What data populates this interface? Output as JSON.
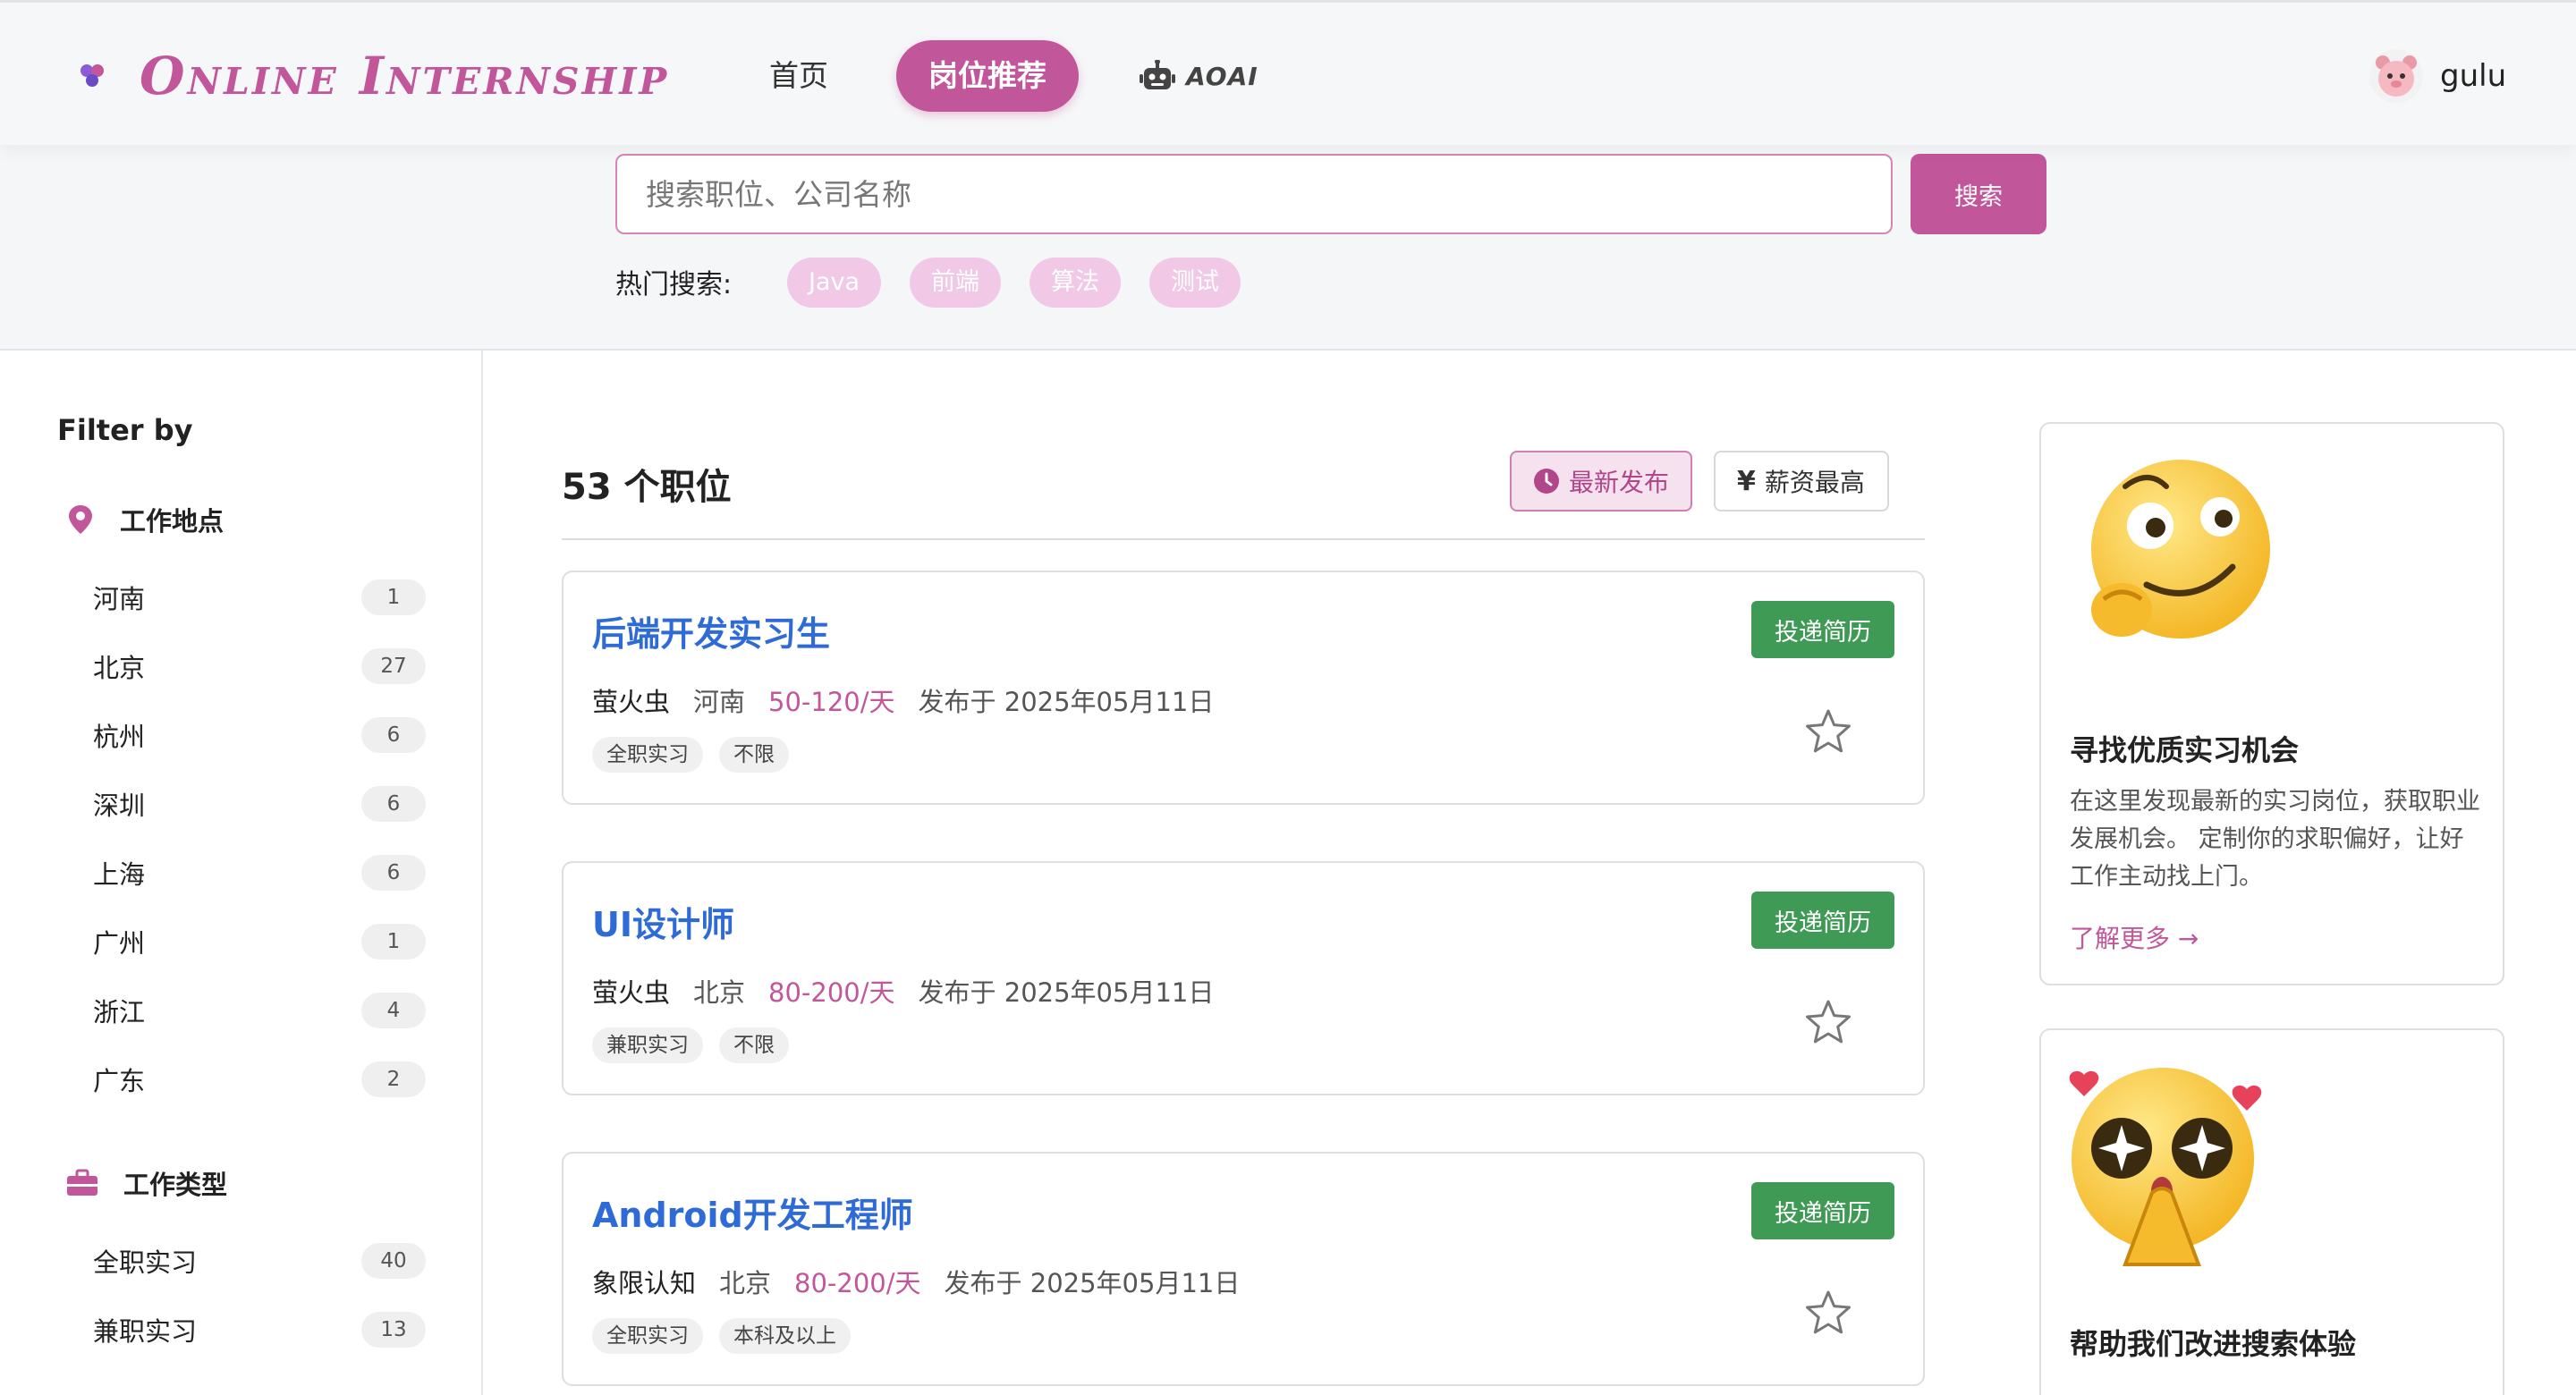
{
  "header": {
    "brand": "Online Internship",
    "nav": {
      "home": "首页",
      "jobs": "岗位推荐",
      "ai": "AOAI"
    },
    "user": {
      "name": "gulu"
    }
  },
  "search": {
    "placeholder": "搜索职位、公司名称",
    "button": "搜索",
    "hot_label": "热门搜索:",
    "hot_tags": [
      "Java",
      "前端",
      "算法",
      "测试"
    ]
  },
  "sidebar": {
    "title": "Filter by",
    "location_group": {
      "label": "工作地点",
      "items": [
        {
          "name": "河南",
          "count": "1"
        },
        {
          "name": "北京",
          "count": "27"
        },
        {
          "name": "杭州",
          "count": "6"
        },
        {
          "name": "深圳",
          "count": "6"
        },
        {
          "name": "上海",
          "count": "6"
        },
        {
          "name": "广州",
          "count": "1"
        },
        {
          "name": "浙江",
          "count": "4"
        },
        {
          "name": "广东",
          "count": "2"
        }
      ]
    },
    "type_group": {
      "label": "工作类型",
      "items": [
        {
          "name": "全职实习",
          "count": "40"
        },
        {
          "name": "兼职实习",
          "count": "13"
        }
      ]
    }
  },
  "main": {
    "count_text": "53 个职位",
    "sort": {
      "newest": "最新发布",
      "highest_pay": "薪资最高"
    },
    "apply_label": "投递简历",
    "jobs": [
      {
        "title": "后端开发实习生",
        "company": "萤火虫",
        "city": "河南",
        "salary": "50-120/天",
        "date": "发布于 2025年05月11日",
        "tags": [
          "全职实习",
          "不限"
        ]
      },
      {
        "title": "UI设计师",
        "company": "萤火虫",
        "city": "北京",
        "salary": "80-200/天",
        "date": "发布于 2025年05月11日",
        "tags": [
          "兼职实习",
          "不限"
        ]
      },
      {
        "title": "Android开发工程师",
        "company": "象限认知",
        "city": "北京",
        "salary": "80-200/天",
        "date": "发布于 2025年05月11日",
        "tags": [
          "全职实习",
          "本科及以上"
        ]
      }
    ]
  },
  "promos": [
    {
      "title": "寻找优质实习机会",
      "text": "在这里发现最新的实习岗位，获取职业发展机会。 定制你的求职偏好，让好工作主动找上门。",
      "link": "了解更多 →"
    },
    {
      "title": "帮助我们改进搜索体验"
    }
  ],
  "colors": {
    "brand": "#c2569a",
    "link": "#2f6bd6",
    "apply": "#3f9a55"
  }
}
